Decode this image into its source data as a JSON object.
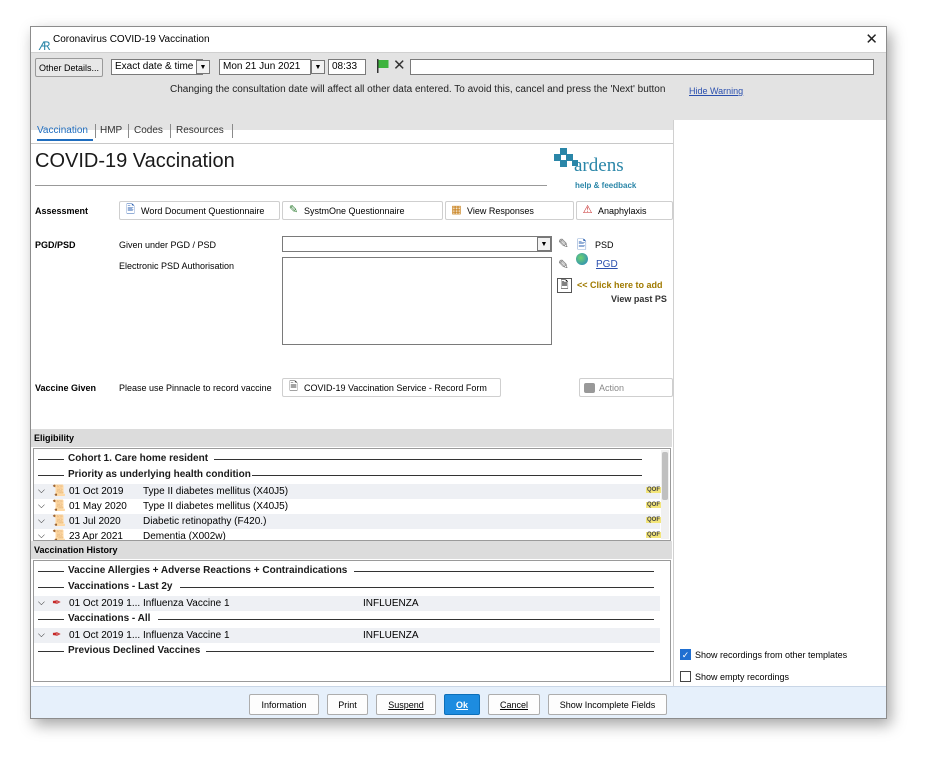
{
  "window": {
    "title": "Coronavirus COVID-19 Vaccination"
  },
  "toolbar": {
    "other_details": "Other Details...",
    "date_mode": "Exact date & time",
    "date": "Mon 21 Jun 2021",
    "time": "08:33",
    "free_text": "",
    "warning": "Changing the consultation date will affect all other data entered. To avoid this, cancel and press the 'Next' button",
    "hide_warning": "Hide Warning"
  },
  "tabs": [
    "Vaccination",
    "HMP",
    "Codes",
    "Resources"
  ],
  "page_title": "COVID-19 Vaccination",
  "logo": {
    "name": "ardens",
    "sub": "help & feedback"
  },
  "assessment": {
    "label": "Assessment",
    "buttons": [
      "Word Document Questionnaire",
      "SystmOne Questionnaire",
      "View Responses",
      "Anaphylaxis"
    ]
  },
  "pgd": {
    "label": "PGD/PSD",
    "given_under": "Given under PGD / PSD",
    "electronic_psd": "Electronic PSD Authorisation",
    "psd": "PSD",
    "pgd_link": "PGD",
    "click_add": "<< Click here to add",
    "view_past": "View past PS"
  },
  "vaccine_given": {
    "label": "Vaccine Given",
    "note": "Please use Pinnacle to record vaccine",
    "form_button": "COVID-19 Vaccination Service - Record Form",
    "action": "Action"
  },
  "eligibility": {
    "header": "Eligibility",
    "groups": [
      "Cohort 1. Care home resident",
      "Priority as underlying health condition"
    ],
    "rows": [
      {
        "date": "01 Oct 2019",
        "desc": "Type II diabetes mellitus (X40J5)",
        "tag": "QOF"
      },
      {
        "date": "01 May 2020",
        "desc": "Type II diabetes mellitus (X40J5)",
        "tag": "QOF"
      },
      {
        "date": "01 Jul 2020",
        "desc": "Diabetic retinopathy (F420.)",
        "tag": "QOF"
      },
      {
        "date": "23 Apr 2021",
        "desc": "Dementia (X002w)",
        "tag": "QOF"
      }
    ]
  },
  "history": {
    "header": "Vaccination History",
    "groups": [
      "Vaccine Allergies + Adverse Reactions + Contraindications",
      "Vaccinations - Last 2y",
      "Vaccinations - All",
      "Previous Declined Vaccines"
    ],
    "last2y": {
      "date": "01 Oct 2019 1...",
      "desc": "Influenza Vaccine 1",
      "type": "INFLUENZA"
    },
    "all": {
      "date": "01 Oct 2019 1...",
      "desc": "Influenza Vaccine 1",
      "type": "INFLUENZA"
    }
  },
  "options": {
    "show_other_templates": "Show recordings from other templates",
    "show_empty": "Show empty recordings"
  },
  "footer": {
    "information": "Information",
    "print": "Print",
    "suspend": "Suspend",
    "ok": "Ok",
    "cancel": "Cancel",
    "show_incomplete": "Show Incomplete Fields"
  },
  "colors": {
    "accent": "#1d8ce0",
    "logo": "#2a86a8",
    "click_add": "#a07a00"
  }
}
